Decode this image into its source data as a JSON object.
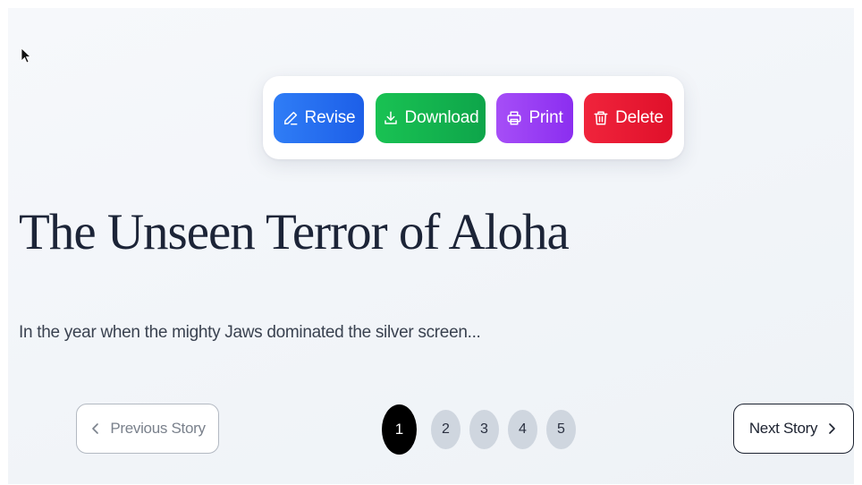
{
  "toolbar": {
    "revise": {
      "label": "Revise",
      "icon": "pencil-icon",
      "color": "#2f7df6"
    },
    "download": {
      "label": "Download",
      "icon": "download-icon",
      "color": "#19c253"
    },
    "print": {
      "label": "Print",
      "icon": "printer-icon",
      "color": "#a64ef7"
    },
    "delete": {
      "label": "Delete",
      "icon": "trash-icon",
      "color": "#f0243c"
    }
  },
  "story": {
    "title": "The Unseen Terror of Aloha",
    "excerpt": "In the year when the mighty Jaws dominated the silver screen..."
  },
  "navigation": {
    "previous_label": "Previous Story",
    "next_label": "Next Story",
    "pages": [
      "1",
      "2",
      "3",
      "4",
      "5"
    ],
    "current_page": "1"
  }
}
